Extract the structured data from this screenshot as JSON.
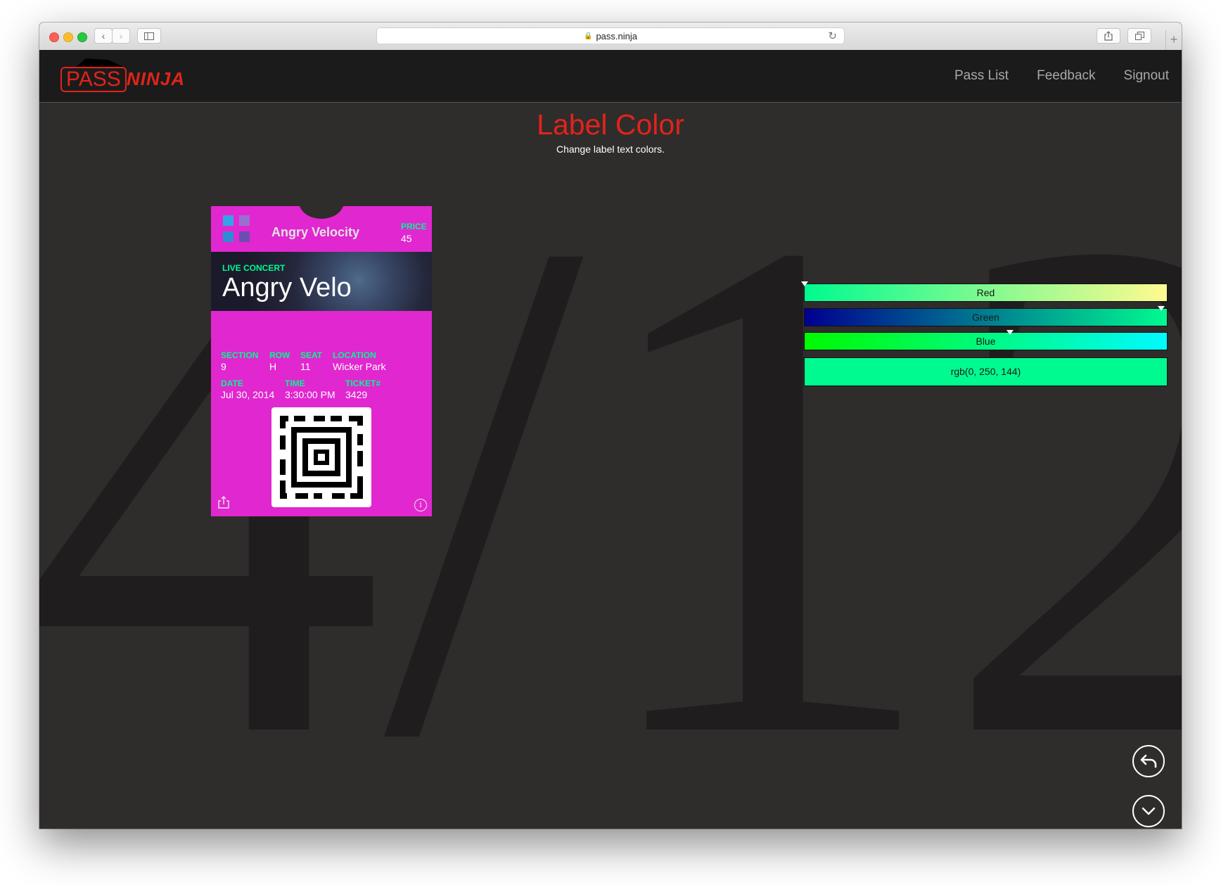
{
  "browser": {
    "url": "pass.ninja",
    "back_icon": "chevron-left-icon",
    "forward_icon": "chevron-right-icon",
    "sidebar_icon": "sidebar-icon",
    "reload_icon": "reload-icon",
    "share_icon": "share-icon",
    "tabs_icon": "tabs-icon",
    "new_tab_label": "+"
  },
  "navbar": {
    "logo_pass": "PASS",
    "logo_ninja": "NINJA",
    "links": [
      "Pass List",
      "Feedback",
      "Signout"
    ]
  },
  "page": {
    "title": "Label Color",
    "subtitle": "Change label text colors.",
    "step_current": "4",
    "step_total": "12",
    "background_numeral": "4/12"
  },
  "pass": {
    "background_color": "#e127cf",
    "label_color": "#00f990",
    "organization": "Angry Velocity",
    "header_field": {
      "label": "PRICE",
      "value": "45"
    },
    "primary_field": {
      "label": "LIVE CONCERT",
      "value": "Angry Velo"
    },
    "secondary_fields": [
      {
        "label": "SECTION",
        "value": "9"
      },
      {
        "label": "ROW",
        "value": "H"
      },
      {
        "label": "SEAT",
        "value": "11"
      },
      {
        "label": "LOCATION",
        "value": "Wicker Park"
      }
    ],
    "auxiliary_fields": [
      {
        "label": "DATE",
        "value": "Jul 30, 2014"
      },
      {
        "label": "TIME",
        "value": "3:30:00 PM"
      },
      {
        "label": "TICKET#",
        "value": "3429"
      }
    ],
    "barcode_type": "aztec",
    "info_glyph": "i"
  },
  "color_picker": {
    "sliders": [
      {
        "name": "Red",
        "value": 0
      },
      {
        "name": "Green",
        "value": 250
      },
      {
        "name": "Blue",
        "value": 144
      }
    ],
    "result_label": "rgb(0, 250, 144)",
    "result_color": "#00fa90"
  },
  "controls": {
    "undo_icon": "undo-arrow-icon",
    "next_icon": "chevron-down-icon"
  }
}
